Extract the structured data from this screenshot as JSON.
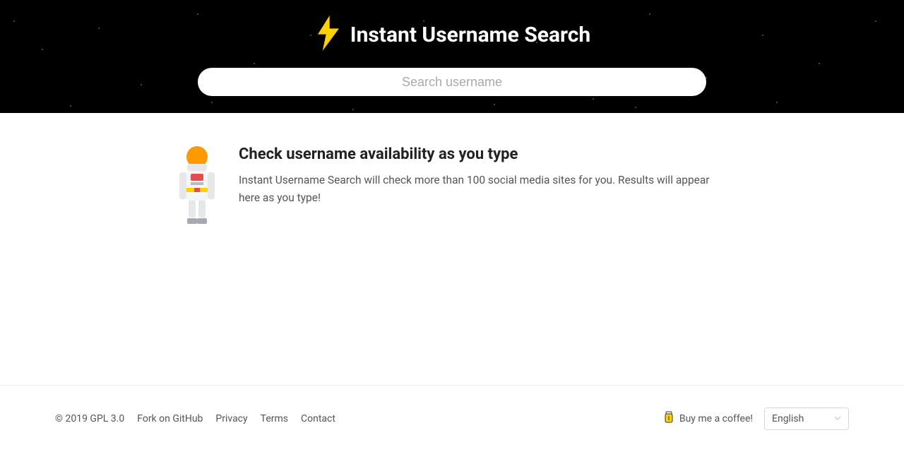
{
  "header": {
    "title": "Instant Username Search",
    "search_placeholder": "Search username"
  },
  "main": {
    "heading": "Check username availability as you type",
    "body": "Instant Username Search will check more than 100 social media sites for you. Results will appear here as you type!"
  },
  "footer": {
    "copyright": "© 2019 GPL 3.0",
    "links": {
      "fork": "Fork on GitHub",
      "privacy": "Privacy",
      "terms": "Terms",
      "contact": "Contact"
    },
    "coffee": "Buy me a coffee!",
    "language_selected": "English"
  },
  "colors": {
    "accent_yellow": "#FFD100",
    "astro_orange": "#FF9900"
  }
}
